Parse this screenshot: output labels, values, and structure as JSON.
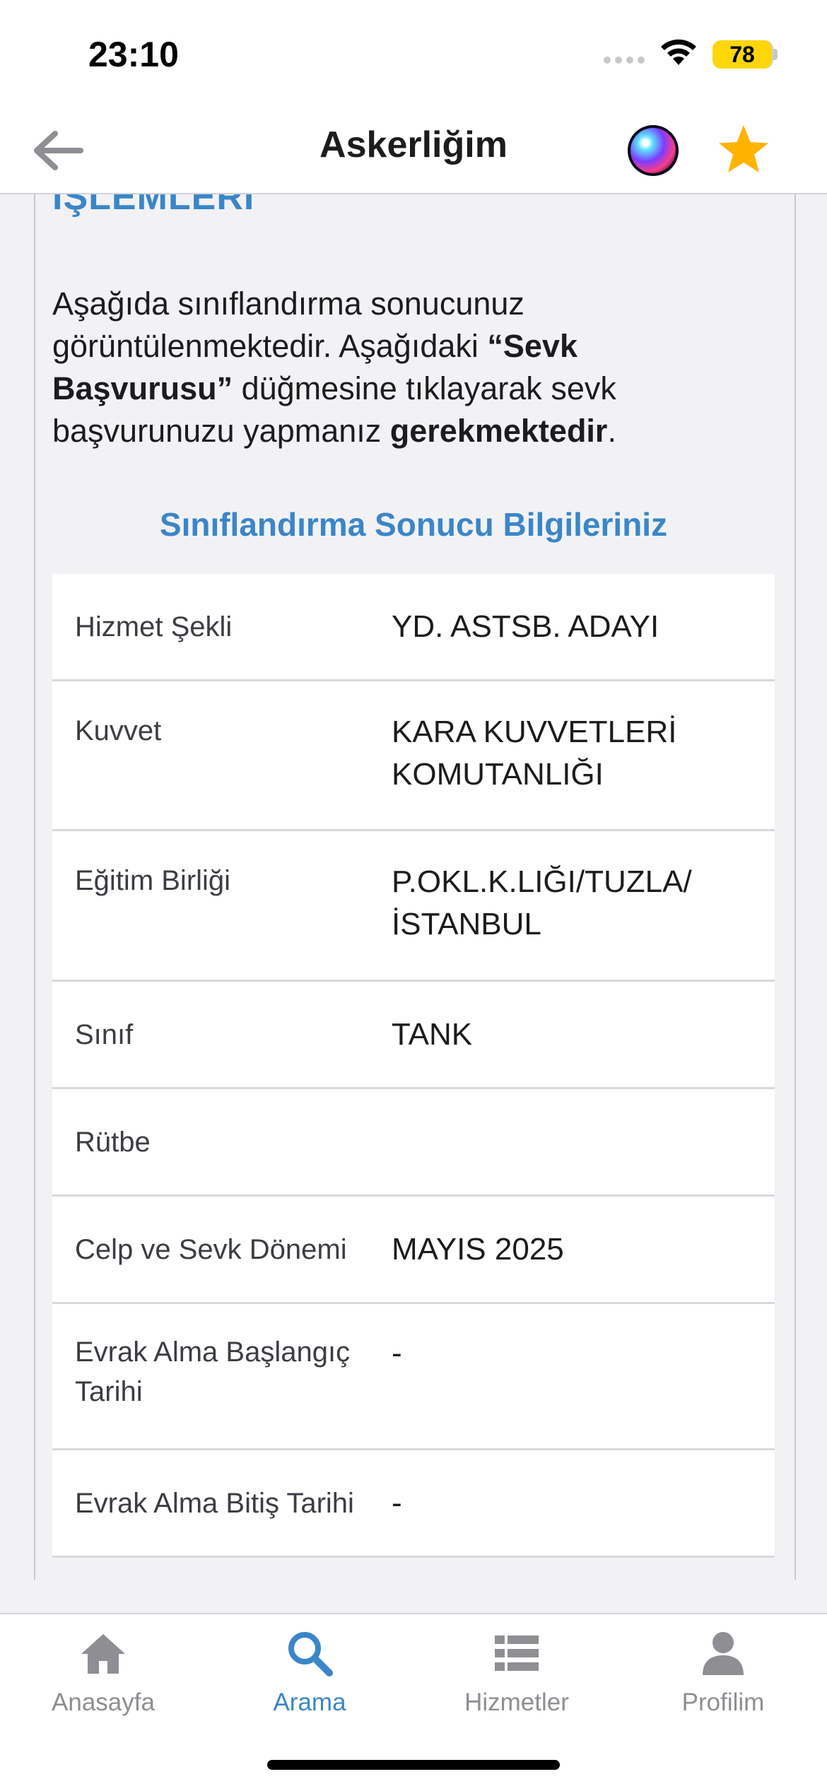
{
  "status_bar": {
    "time": "23:10",
    "battery": "78"
  },
  "nav": {
    "title": "Askerliğim"
  },
  "content": {
    "section_heading_cut": "İŞLEMLERİ",
    "intro_parts": {
      "p1": "Aşağıda sınıflandırma sonucunuz görüntülenmektedir. Aşağıdaki ",
      "p2": "“Sevk Başvurusu”",
      "p3": " düğmesine tıklayarak sevk başvurunuzu yapmanız ",
      "p4": "gerekmektedir",
      "p5": "."
    },
    "subtitle": "Sınıflandırma Sonucu Bilgileriniz",
    "rows": [
      {
        "label": "Hizmet Şekli",
        "value": "YD. ASTSB. ADAYI"
      },
      {
        "label": "Kuvvet",
        "value": "KARA KUVVETLERİ KOMUTANLIĞI"
      },
      {
        "label": "Eğitim Birliği",
        "value": "P.OKL.K.LIĞI/TUZLA/ İSTANBUL"
      },
      {
        "label": "Sınıf",
        "value": "TANK"
      },
      {
        "label": "Rütbe",
        "value": ""
      },
      {
        "label": "Celp ve Sevk Dönemi",
        "value": "MAYIS 2025"
      },
      {
        "label": "Evrak Alma Başlangıç Tarihi",
        "value": "-"
      },
      {
        "label": "Evrak Alma Bitiş Tarihi",
        "value": "-"
      }
    ]
  },
  "tabs": [
    {
      "label": "Anasayfa",
      "icon": "home-icon"
    },
    {
      "label": "Arama",
      "icon": "search-icon",
      "active": true
    },
    {
      "label": "Hizmetler",
      "icon": "list-icon"
    },
    {
      "label": "Profilim",
      "icon": "person-icon"
    }
  ],
  "colors": {
    "accent": "#3a86c8",
    "battery": "#ffd60a",
    "star": "#ffb300"
  }
}
